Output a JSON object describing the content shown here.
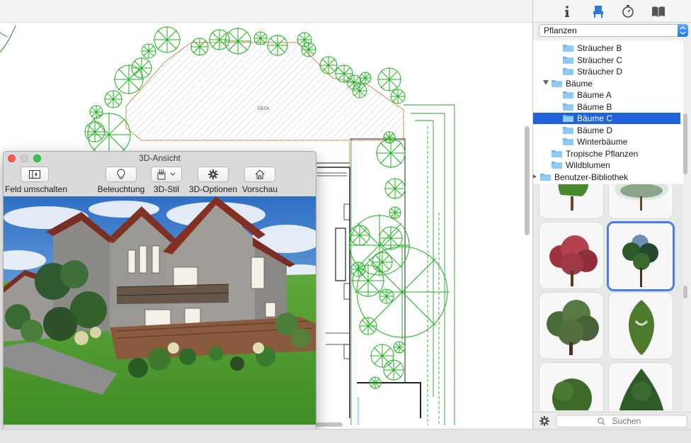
{
  "plan": {
    "deck_label": "DECK"
  },
  "window3d": {
    "title": "3D-Ansicht",
    "toolbar": {
      "toggle_panel": "Feld umschalten",
      "lighting": "Beleuchtung",
      "style": "3D-Stil",
      "options": "3D-Optionen",
      "preview": "Vorschau"
    }
  },
  "library": {
    "tabs": [
      "info-icon",
      "furniture-icon",
      "timer-icon",
      "book-icon"
    ],
    "category_select": "Pflanzen",
    "tree": [
      {
        "label": "Sträucher B",
        "level": 2,
        "selected": false
      },
      {
        "label": "Sträucher C",
        "level": 2,
        "selected": false
      },
      {
        "label": "Sträucher D",
        "level": 2,
        "selected": false
      },
      {
        "label": "Bäume",
        "level": 1,
        "expanded": true,
        "selected": false
      },
      {
        "label": "Bäume A",
        "level": 2,
        "selected": false
      },
      {
        "label": "Bäume B",
        "level": 2,
        "selected": false
      },
      {
        "label": "Bäume C",
        "level": 2,
        "selected": true
      },
      {
        "label": "Bäume D",
        "level": 2,
        "selected": false
      },
      {
        "label": "Winterbäume",
        "level": 2,
        "selected": false
      },
      {
        "label": "Tropische Pflanzen",
        "level": 1,
        "selected": false
      },
      {
        "label": "Wildblumen",
        "level": 1,
        "selected": false
      },
      {
        "label": "Benutzer-Bibliothek",
        "level": 0,
        "expanded": false,
        "selected": false
      }
    ],
    "search_placeholder": "Suchen"
  },
  "colors": {
    "accent_blue": "#1e64d8",
    "plan_green": "#1ab31a",
    "selection_border": "#4e7de8",
    "folder_blue": "#6cb7f0"
  }
}
